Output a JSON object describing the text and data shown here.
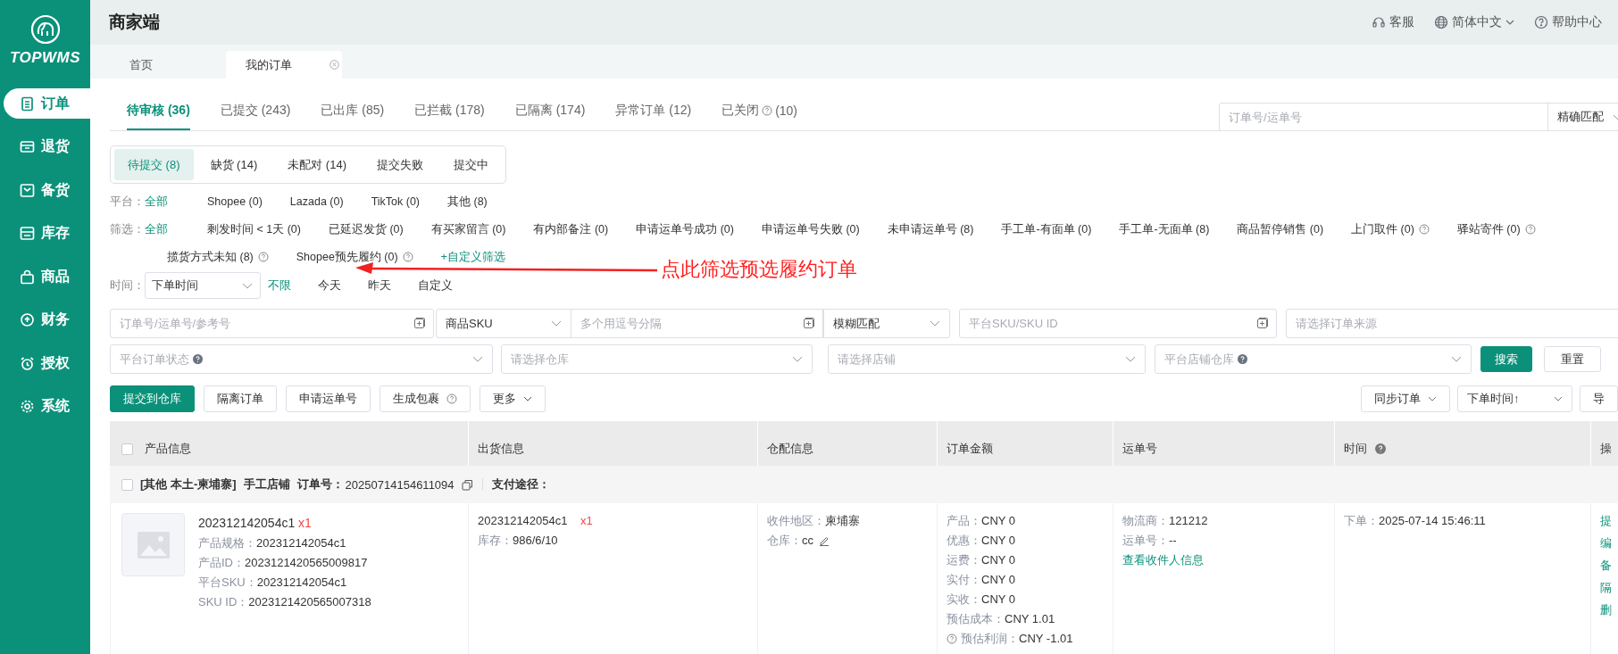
{
  "sidebar": {
    "logo": "TOPWMS",
    "items": [
      {
        "label": "订单",
        "selected": true
      },
      {
        "label": "退货",
        "selected": false
      },
      {
        "label": "备货",
        "selected": false
      },
      {
        "label": "库存",
        "selected": false
      },
      {
        "label": "商品",
        "selected": false
      },
      {
        "label": "财务",
        "selected": false
      },
      {
        "label": "授权",
        "selected": false
      },
      {
        "label": "系统",
        "selected": false
      }
    ]
  },
  "header": {
    "title": "商家端",
    "links": [
      {
        "label": "客服",
        "dropdown": false
      },
      {
        "label": "简体中文",
        "dropdown": true
      },
      {
        "label": "帮助中心",
        "dropdown": false
      }
    ]
  },
  "page_tabs": [
    {
      "label": "首页",
      "selected": false,
      "closable": false
    },
    {
      "label": "我的订单",
      "selected": true,
      "closable": true
    }
  ],
  "status_tabs": [
    {
      "label": "待审核",
      "count": "(36)",
      "help": false,
      "selected": true
    },
    {
      "label": "已提交",
      "count": "(243)",
      "help": false,
      "selected": false
    },
    {
      "label": "已出库",
      "count": "(85)",
      "help": false,
      "selected": false
    },
    {
      "label": "已拦截",
      "count": "(178)",
      "help": false,
      "selected": false
    },
    {
      "label": "已隔离",
      "count": "(174)",
      "help": false,
      "selected": false
    },
    {
      "label": "异常订单",
      "count": "(12)",
      "help": false,
      "selected": false
    },
    {
      "label": "已关闭",
      "count": "(10)",
      "help": true,
      "selected": false
    }
  ],
  "quick_search": {
    "placeholder": "订单号/运单号",
    "match": "精确匹配"
  },
  "sub_tabs": [
    {
      "label": "待提交 (8)",
      "selected": true
    },
    {
      "label": "缺货 (14)",
      "selected": false
    },
    {
      "label": "未配对 (14)",
      "selected": false
    },
    {
      "label": "提交失败",
      "selected": false
    },
    {
      "label": "提交中",
      "selected": false
    }
  ],
  "platform_filter": {
    "label": "平台：",
    "options": [
      {
        "label": "全部",
        "selected": true
      },
      {
        "label": "Shopee (0)",
        "selected": false
      },
      {
        "label": "Lazada (0)",
        "selected": false
      },
      {
        "label": "TikTok (0)",
        "selected": false
      },
      {
        "label": "其他 (8)",
        "selected": false
      }
    ]
  },
  "filter": {
    "label": "筛选：",
    "options": [
      {
        "label": "全部",
        "kind": "option",
        "selected": true,
        "help": false
      },
      {
        "label": "剩发时间 < 1天 (0)",
        "kind": "option",
        "selected": false,
        "help": false
      },
      {
        "label": "已延迟发货 (0)",
        "kind": "option",
        "selected": false,
        "help": false
      },
      {
        "label": "有买家留言 (0)",
        "kind": "option",
        "selected": false,
        "help": false
      },
      {
        "label": "有内部备注 (0)",
        "kind": "option",
        "selected": false,
        "help": false
      },
      {
        "label": "申请运单号成功 (0)",
        "kind": "option",
        "selected": false,
        "help": false
      },
      {
        "label": "申请运单号失败 (0)",
        "kind": "option",
        "selected": false,
        "help": false
      },
      {
        "label": "未申请运单号 (8)",
        "kind": "option",
        "selected": false,
        "help": false
      },
      {
        "label": "手工单-有面单 (0)",
        "kind": "option",
        "selected": false,
        "help": false
      },
      {
        "label": "手工单-无面单 (8)",
        "kind": "option",
        "selected": false,
        "help": false
      },
      {
        "label": "商品暂停销售 (0)",
        "kind": "option",
        "selected": false,
        "help": false
      },
      {
        "label": "上门取件 (0)",
        "kind": "option",
        "selected": false,
        "help": true
      },
      {
        "label": "驿站寄件 (0)",
        "kind": "option",
        "selected": false,
        "help": true
      },
      {
        "label": "揽货方式未知 (8)",
        "kind": "option",
        "selected": false,
        "help": true
      },
      {
        "label": "Shopee预先履约 (0)",
        "kind": "option",
        "selected": false,
        "help": true
      },
      {
        "label": "+自定义筛选",
        "kind": "link",
        "help": false
      }
    ]
  },
  "time_filter": {
    "label": "时间：",
    "field": "下单时间",
    "options": [
      {
        "label": "不限",
        "selected": true
      },
      {
        "label": "今天",
        "selected": false
      },
      {
        "label": "昨天",
        "selected": false
      },
      {
        "label": "自定义",
        "selected": false
      }
    ]
  },
  "search_form": {
    "row_1": [
      {
        "kind": "input",
        "placeholder": "订单号/运单号/参考号",
        "expandable": true
      },
      {
        "kind": "select",
        "value": "商品SKU"
      },
      {
        "kind": "input",
        "placeholder": "多个用逗号分隔",
        "expandable": true
      },
      {
        "kind": "select",
        "value": "模糊匹配"
      },
      {
        "kind": "input",
        "placeholder": "平台SKU/SKU ID",
        "expandable": true
      },
      {
        "kind": "input",
        "placeholder": "请选择订单来源",
        "expandable": false
      }
    ],
    "row_2": [
      {
        "kind": "select",
        "placeholder": "平台订单状态",
        "help": true
      },
      {
        "kind": "select",
        "placeholder": "请选择仓库",
        "help": false
      },
      {
        "kind": "select",
        "placeholder": "请选择店铺",
        "help": false
      },
      {
        "kind": "select",
        "placeholder": "平台店铺仓库",
        "help": true
      }
    ],
    "buttons": [
      {
        "label": "搜索",
        "kind": "primary"
      },
      {
        "label": "重置",
        "kind": "default"
      }
    ]
  },
  "actions": [
    {
      "label": "提交到仓库",
      "kind": "primary",
      "help": false
    },
    {
      "label": "隔离订单",
      "kind": "default",
      "help": false
    },
    {
      "label": "申请运单号",
      "kind": "default",
      "help": false
    },
    {
      "label": "生成包裹",
      "kind": "default",
      "help": true
    },
    {
      "label": "更多",
      "kind": "dropdown",
      "help": false
    }
  ],
  "right_actions": [
    {
      "label": "同步订单",
      "kind": "dropdown"
    },
    {
      "label": "下单时间↑",
      "kind": "select"
    },
    {
      "label": "导",
      "kind": "default"
    }
  ],
  "annotation": {
    "text": "点此筛选预选履约订单"
  },
  "table": {
    "all_checked": false,
    "columns": [
      {
        "label": "产品信息",
        "help": false
      },
      {
        "label": "出货信息",
        "help": false
      },
      {
        "label": "仓配信息",
        "help": false
      },
      {
        "label": "订单金额",
        "help": false
      },
      {
        "label": "运单号",
        "help": false
      },
      {
        "label": "时间",
        "help": true
      },
      {
        "label": "操",
        "help": false
      }
    ],
    "orders": [
      {
        "checked": false,
        "header": {
          "tags": "[其他 本土-柬埔寨]",
          "shop": "手工店铺",
          "order_no_label": "订单号：",
          "order_no": "20250714154611094",
          "payment_label": "支付途径："
        },
        "product": {
          "name": "202312142054c1",
          "qty": "x1",
          "details": [
            {
              "label": "产品规格：",
              "value": "202312142054c1"
            },
            {
              "label": "产品ID：",
              "value": "2023121420565009817"
            },
            {
              "label": "平台SKU：",
              "value": "202312142054c1"
            },
            {
              "label": "SKU ID：",
              "value": "2023121420565007318"
            }
          ]
        },
        "shipment": {
          "sku": "202312142054c1",
          "qty": "x1",
          "stock_label": "库存：",
          "stock": "986/6/10"
        },
        "warehouse": [
          {
            "label": "收件地区：",
            "value": "柬埔寨",
            "editable": false
          },
          {
            "label": "仓库：",
            "value": "cc",
            "editable": true
          }
        ],
        "amounts": [
          {
            "label": "产品：",
            "value": "CNY 0",
            "help": false
          },
          {
            "label": "优惠：",
            "value": "CNY 0",
            "help": false
          },
          {
            "label": "运费：",
            "value": "CNY 0",
            "help": false
          },
          {
            "label": "实付：",
            "value": "CNY 0",
            "help": false
          },
          {
            "label": "实收：",
            "value": "CNY 0",
            "help": false
          },
          {
            "label": "预估成本：",
            "value": "CNY 1.01",
            "help": false
          },
          {
            "label": "预估利润：",
            "value": "CNY -1.01",
            "help": true
          }
        ],
        "waybill": {
          "carrier_label": "物流商：",
          "carrier": "121212",
          "number_label": "运单号：",
          "number": "--",
          "link": "查看收件人信息"
        },
        "time": {
          "label": "下单：",
          "value": "2025-07-14 15:46:11"
        },
        "operations": [
          "提",
          "编",
          "备",
          "隔",
          "删"
        ]
      }
    ]
  }
}
